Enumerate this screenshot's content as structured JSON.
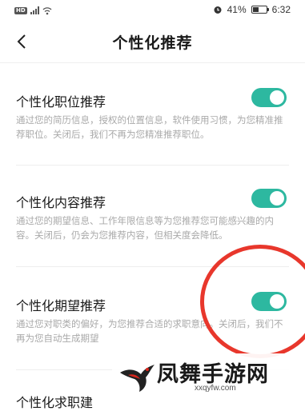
{
  "status_bar": {
    "battery_text": "41%",
    "battery_level": 0.41,
    "time": "6:32"
  },
  "header": {
    "title": "个性化推荐"
  },
  "settings": [
    {
      "title": "个性化职位推荐",
      "description": "通过您的简历信息，授权的位置信息，软件使用习惯，为您精准推荐职位。关闭后，我们不再为您精准推荐职位。",
      "enabled": true
    },
    {
      "title": "个性化内容推荐",
      "description": "通过您的期望信息、工作年限信息等为您推荐您可能感兴趣的内容。关闭后，仍会为您推荐内容，但相关度会降低。",
      "enabled": true
    },
    {
      "title": "个性化期望推荐",
      "description": "通过您对职类的偏好，为您推荐合适的求职意向。关闭后，我们不再为您自动生成期望",
      "enabled": true
    },
    {
      "title": "个性化求职建"
    }
  ],
  "watermark": {
    "name": "凤舞手游网",
    "url": "xxqyfw.com"
  },
  "colors": {
    "toggle_on": "#2db8a0",
    "annotation": "#e8372c"
  }
}
